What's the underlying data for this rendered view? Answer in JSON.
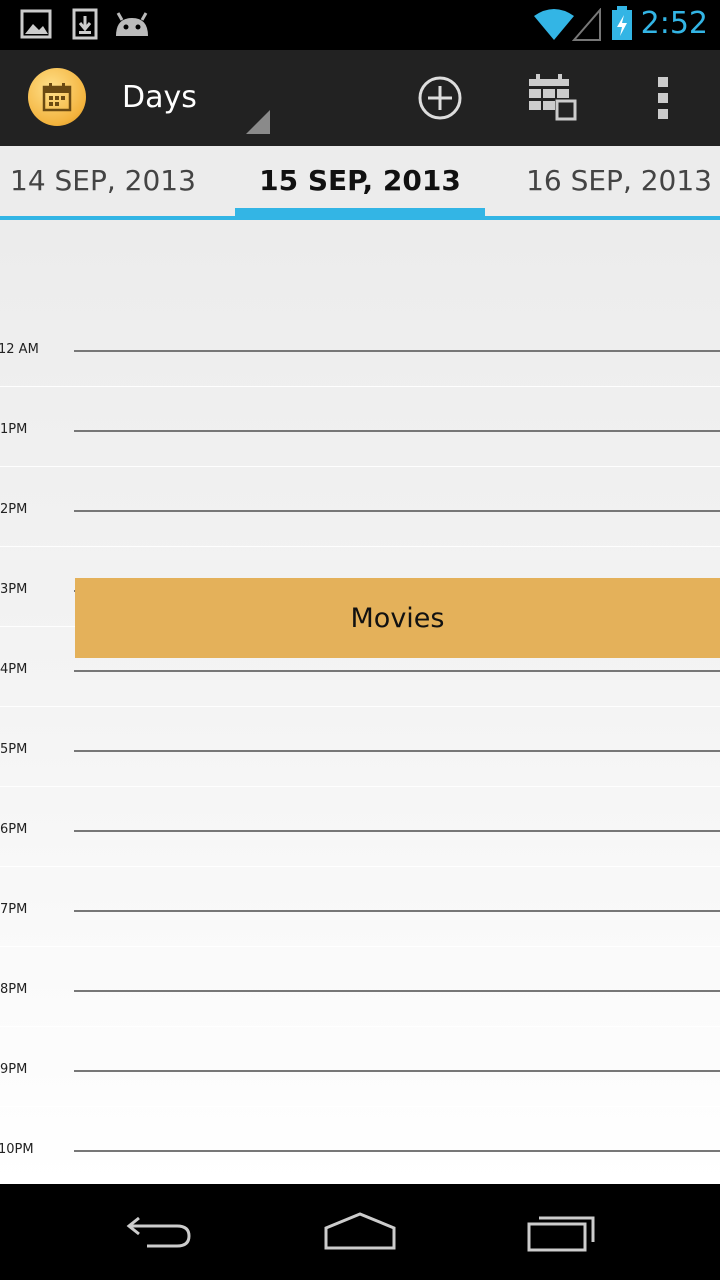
{
  "status_bar": {
    "time": "2:52",
    "icons": [
      "gallery-icon",
      "download-icon",
      "android-icon",
      "wifi-icon",
      "signal-icon",
      "battery-charging-icon"
    ]
  },
  "action_bar": {
    "app_icon": "calendar-icon",
    "view_selector": "Days",
    "actions": [
      "add-circle-icon",
      "calendar-grid-icon",
      "overflow-menu-icon"
    ]
  },
  "date_tabs": {
    "previous": "14 SEP, 2013",
    "current": "15 SEP, 2013",
    "next": "16 SEP, 2013"
  },
  "day_view": {
    "hours": [
      "12 AM",
      "1PM",
      "2PM",
      "3PM",
      "4PM",
      "5PM",
      "6PM",
      "7PM",
      "8PM",
      "9PM",
      "10PM"
    ],
    "events": [
      {
        "title": "Movies",
        "start": "3PM",
        "end": "4PM",
        "color": "#e4b15a"
      }
    ]
  },
  "nav_bar": {
    "buttons": [
      "back-icon",
      "home-icon",
      "recent-apps-icon"
    ]
  },
  "colors": {
    "accent": "#33b5e5",
    "action_bar": "#222222",
    "event": "#e4b15a"
  }
}
